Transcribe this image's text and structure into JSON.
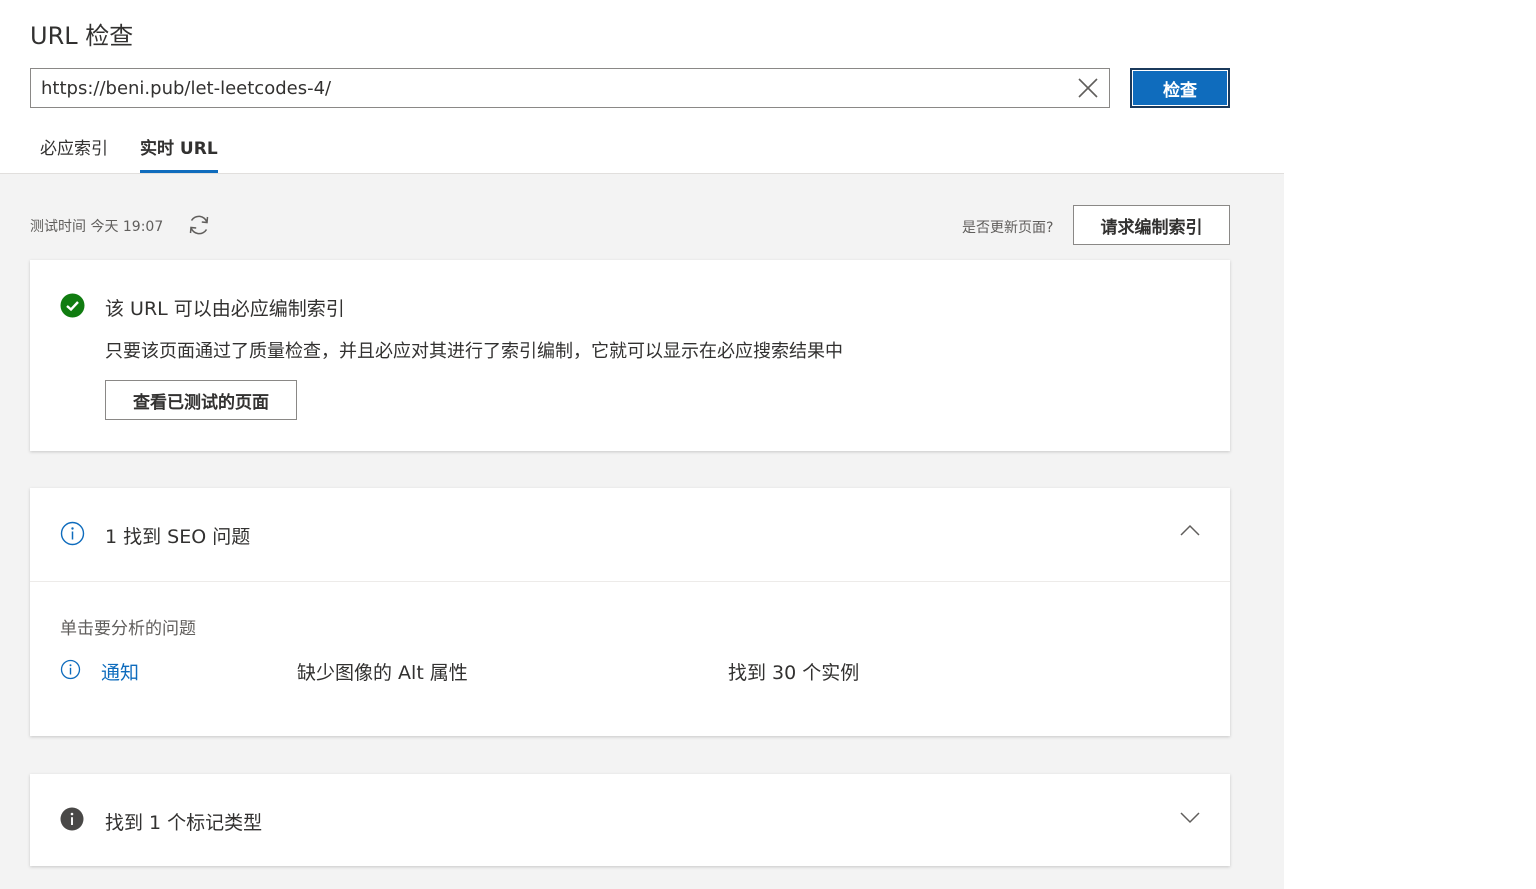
{
  "header": {
    "title": "URL 检查",
    "url_value": "https://beni.pub/let-leetcodes-4/",
    "inspect_label": "检查"
  },
  "tabs": [
    {
      "label": "必应索引",
      "active": false
    },
    {
      "label": "实时 URL",
      "active": true
    }
  ],
  "toolbar": {
    "test_time": "测试时间 今天 19:07",
    "update_question": "是否更新页面?",
    "request_index_label": "请求编制索引"
  },
  "index_card": {
    "title": "该 URL 可以由必应编制索引",
    "description": "只要该页面通过了质量检查，并且必应对其进行了索引编制，它就可以显示在必应搜索结果中",
    "view_tested_label": "查看已测试的页面"
  },
  "seo_card": {
    "title": "1 找到 SEO 问题",
    "hint": "单击要分析的问题",
    "issues": [
      {
        "severity": "通知",
        "description": "缺少图像的 Alt 属性",
        "count": "找到 30 个实例"
      }
    ]
  },
  "markup_card": {
    "title": "找到 1 个标记类型"
  },
  "colors": {
    "accent": "#0f6cbd",
    "success": "#107c10",
    "background": "#f3f3f3"
  },
  "icons": [
    "close-icon",
    "refresh-icon",
    "check-circle-icon",
    "info-circle-icon",
    "chevron-up-icon",
    "chevron-down-icon"
  ]
}
